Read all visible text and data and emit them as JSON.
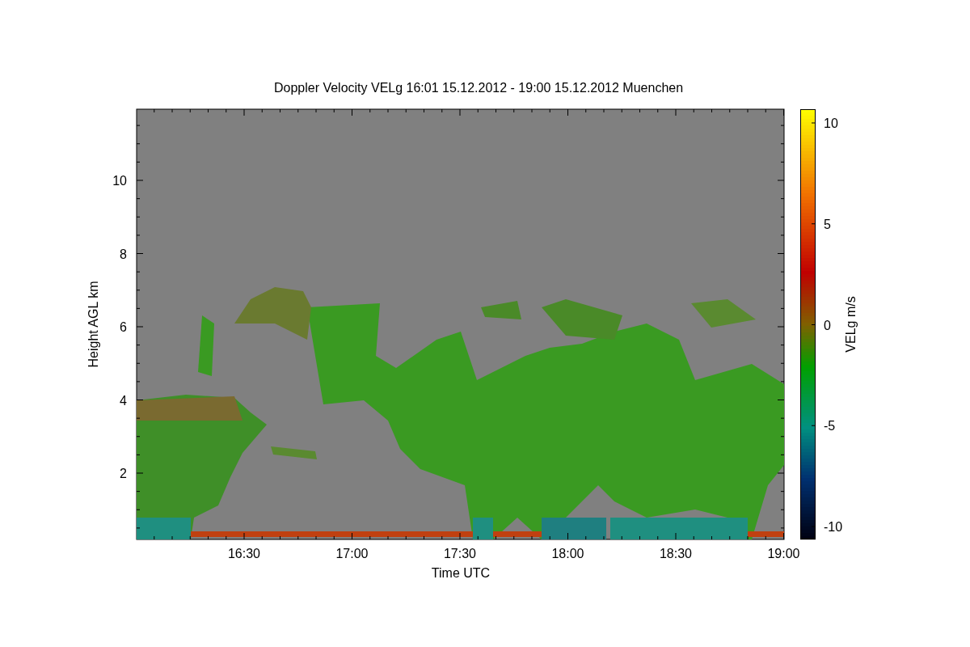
{
  "plot": {
    "title": "Doppler Velocity VELg   16:01 15.12.2012 - 19:00 15.12.2012 Muenchen",
    "xlabel": "Time UTC",
    "ylabel": "Height AGL km",
    "xticks": [
      "16:30",
      "17:00",
      "17:30",
      "18:00",
      "18:30",
      "19:00"
    ],
    "yticks": [
      "10",
      "8",
      "6",
      "4",
      "2"
    ]
  },
  "colorbar": {
    "label": "VELg m/s",
    "ticks": [
      "10",
      "5",
      "0",
      "-5",
      "-10"
    ]
  }
}
